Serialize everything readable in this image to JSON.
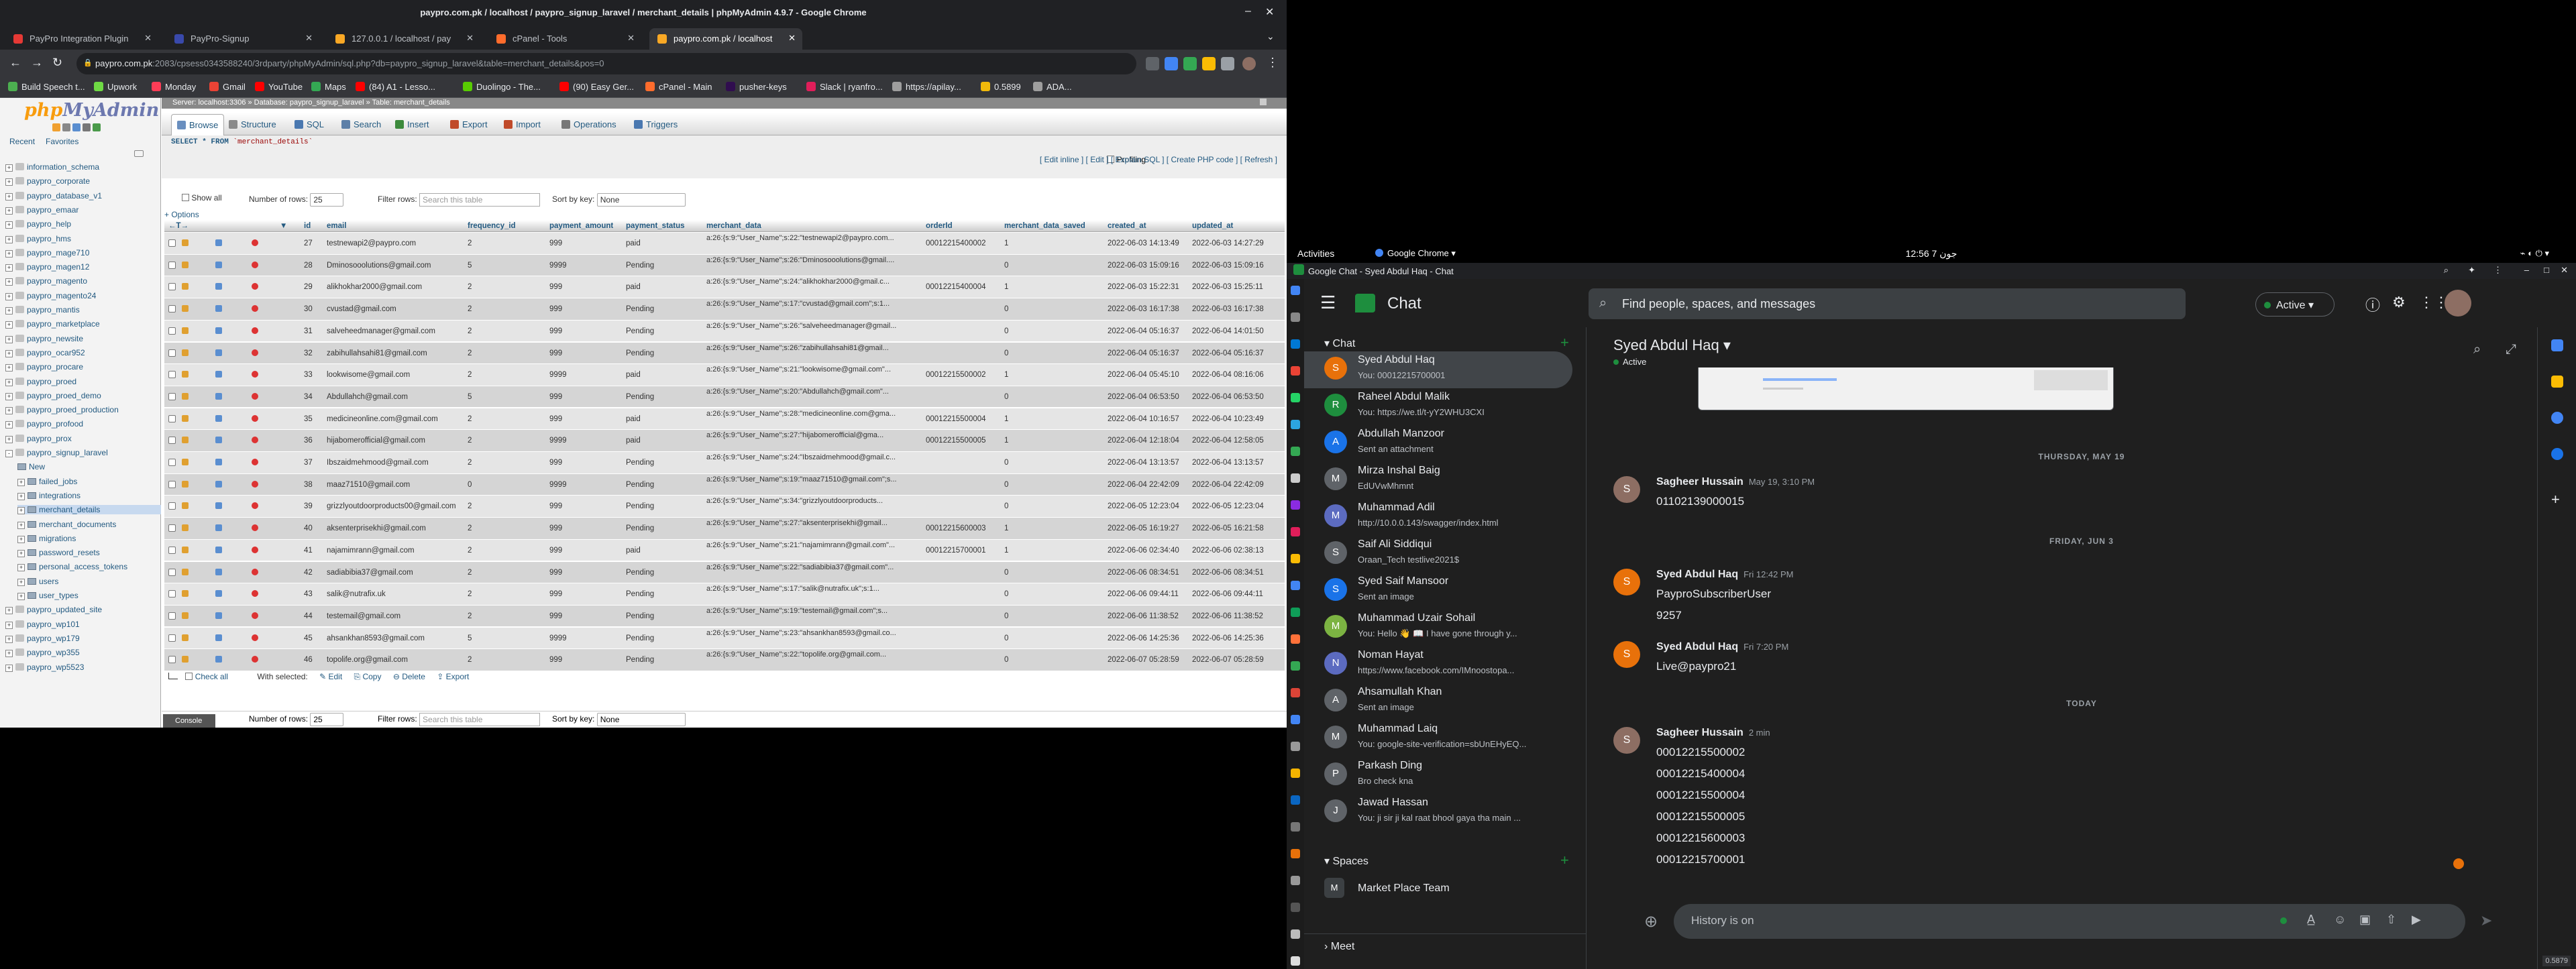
{
  "left_window": {
    "title": "paypro.com.pk / localhost / paypro_signup_laravel / merchant_details | phpMyAdmin 4.9.7 - Google Chrome",
    "tabs": [
      {
        "label": "PayPro Integration Plugin",
        "color": "#e53935"
      },
      {
        "label": "PayPro-Signup",
        "color": "#3949ab"
      },
      {
        "label": "127.0.0.1 / localhost / pay",
        "color": "#f9a825"
      },
      {
        "label": "cPanel - Tools",
        "color": "#ff6c2c"
      },
      {
        "label": "paypro.com.pk / localhost",
        "color": "#f9a825"
      }
    ],
    "url_host": "paypro.com.pk",
    "url_rest": ":2083/cpsess0343588240/3rdparty/phpMyAdmin/sql.php?db=paypro_signup_laravel&table=merchant_details&pos=0",
    "bookmarks": [
      {
        "label": "Build Speech t...",
        "color": "#4caf50"
      },
      {
        "label": "Upwork",
        "color": "#6fda44"
      },
      {
        "label": "Monday",
        "color": "#ff3d57"
      },
      {
        "label": "Gmail",
        "color": "#ea4335"
      },
      {
        "label": "YouTube",
        "color": "#ff0000"
      },
      {
        "label": "Maps",
        "color": "#34a853"
      },
      {
        "label": "(84) A1 - Lesso...",
        "color": "#ff0000"
      },
      {
        "label": "Duolingo - The...",
        "color": "#58cc02"
      },
      {
        "label": "(90) Easy Ger...",
        "color": "#ff0000"
      },
      {
        "label": "cPanel - Main",
        "color": "#ff6c2c"
      },
      {
        "label": "pusher-keys",
        "color": "#300d4f"
      },
      {
        "label": "Slack | ryanfro...",
        "color": "#e01e5a"
      },
      {
        "label": "https://apilay...",
        "color": "#9e9e9e"
      },
      {
        "label": "0.5899",
        "color": "#f0b90b"
      },
      {
        "label": "ADA...",
        "color": "#9e9e9e"
      }
    ]
  },
  "pma": {
    "logo_main": "php",
    "logo_accent": "MyAdmin",
    "recent": "Recent",
    "favorites": "Favorites",
    "databases": [
      {
        "name": "information_schema",
        "level": 0,
        "sign": "+"
      },
      {
        "name": "paypro_corporate",
        "level": 0,
        "sign": "+"
      },
      {
        "name": "paypro_database_v1",
        "level": 0,
        "sign": "+"
      },
      {
        "name": "paypro_emaar",
        "level": 0,
        "sign": "+"
      },
      {
        "name": "paypro_help",
        "level": 0,
        "sign": "+"
      },
      {
        "name": "paypro_hms",
        "level": 0,
        "sign": "+"
      },
      {
        "name": "paypro_mage710",
        "level": 0,
        "sign": "+"
      },
      {
        "name": "paypro_magen12",
        "level": 0,
        "sign": "+"
      },
      {
        "name": "paypro_magento",
        "level": 0,
        "sign": "+"
      },
      {
        "name": "paypro_magento24",
        "level": 0,
        "sign": "+"
      },
      {
        "name": "paypro_mantis",
        "level": 0,
        "sign": "+"
      },
      {
        "name": "paypro_marketplace",
        "level": 0,
        "sign": "+"
      },
      {
        "name": "paypro_newsite",
        "level": 0,
        "sign": "+"
      },
      {
        "name": "paypro_ocar952",
        "level": 0,
        "sign": "+"
      },
      {
        "name": "paypro_procare",
        "level": 0,
        "sign": "+"
      },
      {
        "name": "paypro_proed",
        "level": 0,
        "sign": "+"
      },
      {
        "name": "paypro_proed_demo",
        "level": 0,
        "sign": "+"
      },
      {
        "name": "paypro_proed_production",
        "level": 0,
        "sign": "+"
      },
      {
        "name": "paypro_profood",
        "level": 0,
        "sign": "+"
      },
      {
        "name": "paypro_prox",
        "level": 0,
        "sign": "+"
      },
      {
        "name": "paypro_signup_laravel",
        "level": 0,
        "sign": "-"
      },
      {
        "name": "New",
        "level": 1,
        "sign": ""
      },
      {
        "name": "failed_jobs",
        "level": 1,
        "sign": "+"
      },
      {
        "name": "integrations",
        "level": 1,
        "sign": "+"
      },
      {
        "name": "merchant_details",
        "level": 1,
        "sign": "+"
      },
      {
        "name": "merchant_documents",
        "level": 1,
        "sign": "+"
      },
      {
        "name": "migrations",
        "level": 1,
        "sign": "+"
      },
      {
        "name": "password_resets",
        "level": 1,
        "sign": "+"
      },
      {
        "name": "personal_access_tokens",
        "level": 1,
        "sign": "+"
      },
      {
        "name": "users",
        "level": 1,
        "sign": "+"
      },
      {
        "name": "user_types",
        "level": 1,
        "sign": "+"
      },
      {
        "name": "paypro_updated_site",
        "level": 0,
        "sign": "+"
      },
      {
        "name": "paypro_wp101",
        "level": 0,
        "sign": "+"
      },
      {
        "name": "paypro_wp179",
        "level": 0,
        "sign": "+"
      },
      {
        "name": "paypro_wp355",
        "level": 0,
        "sign": "+"
      },
      {
        "name": "paypro_wp5523",
        "level": 0,
        "sign": "+"
      }
    ],
    "server_bar": "Server: localhost:3306 » Database: paypro_signup_laravel » Table: merchant_details",
    "menu": [
      {
        "label": "Browse",
        "color": "#6a8fbf"
      },
      {
        "label": "Structure",
        "color": "#8a8a8a"
      },
      {
        "label": "SQL",
        "color": "#4a78b0"
      },
      {
        "label": "Search",
        "color": "#5d7fa8"
      },
      {
        "label": "Insert",
        "color": "#3c8a3c"
      },
      {
        "label": "Export",
        "color": "#c04a2a"
      },
      {
        "label": "Import",
        "color": "#c04a2a"
      },
      {
        "label": "Operations",
        "color": "#777777"
      },
      {
        "label": "Triggers",
        "color": "#4a78b0"
      }
    ],
    "sql_kw": "SELECT * FROM",
    "sql_table": "`merchant_details`",
    "profiling": "Profiling",
    "sql_links": "[ Edit inline ] [ Edit ] [ Explain SQL ] [ Create PHP code ] [ Refresh ]",
    "show_all": "Show all",
    "num_rows_label": "Number of rows:",
    "num_rows_value": "25",
    "filter_label": "Filter rows:",
    "filter_placeholder": "Search this table",
    "sort_label": "Sort by key:",
    "sort_value": "None",
    "options": "+ Options",
    "columns": [
      "id",
      "email",
      "frequency_id",
      "payment_amount",
      "payment_status",
      "merchant_data",
      "orderId",
      "merchant_data_saved",
      "created_at",
      "updated_at"
    ],
    "action_labels": {
      "edit": "Edit",
      "copy": "Copy",
      "delete": "Delete"
    },
    "rows": [
      {
        "id": "27",
        "email": "testnewapi2@paypro.com",
        "freq": "2",
        "amount": "999",
        "status": "paid",
        "md": "a:26:{s:9:\"User_Name\";s:22:\"testnewapi2@paypro.com...",
        "order": "00012215400002",
        "saved": "1",
        "created": "2022-06-03 14:13:49",
        "updated": "2022-06-03 14:27:29"
      },
      {
        "id": "28",
        "email": "Dminosooolutions@gmail.com",
        "freq": "5",
        "amount": "9999",
        "status": "Pending",
        "md": "a:26:{s:9:\"User_Name\";s:26:\"Dminosooolutions@gmail....",
        "order": "",
        "saved": "0",
        "created": "2022-06-03 15:09:16",
        "updated": "2022-06-03 15:09:16"
      },
      {
        "id": "29",
        "email": "alikhokhar2000@gmail.com",
        "freq": "2",
        "amount": "999",
        "status": "paid",
        "md": "a:26:{s:9:\"User_Name\";s:24:\"alikhokhar2000@gmail.c...",
        "order": "00012215400004",
        "saved": "1",
        "created": "2022-06-03 15:22:31",
        "updated": "2022-06-03 15:25:11"
      },
      {
        "id": "30",
        "email": "cvustad@gmail.com",
        "freq": "2",
        "amount": "999",
        "status": "Pending",
        "md": "a:26:{s:9:\"User_Name\";s:17:\"cvustad@gmail.com\";s:1...",
        "order": "",
        "saved": "0",
        "created": "2022-06-03 16:17:38",
        "updated": "2022-06-03 16:17:38"
      },
      {
        "id": "31",
        "email": "salveheedmanager@gmail.com",
        "freq": "2",
        "amount": "999",
        "status": "Pending",
        "md": "a:26:{s:9:\"User_Name\";s:26:\"salveheedmanager@gmail...",
        "order": "",
        "saved": "0",
        "created": "2022-06-04 05:16:37",
        "updated": "2022-06-04 14:01:50"
      },
      {
        "id": "32",
        "email": "zabihullahsahi81@gmail.com",
        "freq": "2",
        "amount": "999",
        "status": "Pending",
        "md": "a:26:{s:9:\"User_Name\";s:26:\"zabihullahsahi81@gmail...",
        "order": "",
        "saved": "0",
        "created": "2022-06-04 05:16:37",
        "updated": "2022-06-04 05:16:37"
      },
      {
        "id": "33",
        "email": "lookwisome@gmail.com",
        "freq": "2",
        "amount": "9999",
        "status": "paid",
        "md": "a:26:{s:9:\"User_Name\";s:21:\"lookwisome@gmail.com\"...",
        "order": "00012215500002",
        "saved": "1",
        "created": "2022-06-04 05:45:10",
        "updated": "2022-06-04 08:16:06"
      },
      {
        "id": "34",
        "email": "Abdullahch@gmail.com",
        "freq": "5",
        "amount": "999",
        "status": "Pending",
        "md": "a:26:{s:9:\"User_Name\";s:20:\"Abdullahch@gmail.com\"...",
        "order": "",
        "saved": "0",
        "created": "2022-06-04 06:53:50",
        "updated": "2022-06-04 06:53:50"
      },
      {
        "id": "35",
        "email": "medicineonline.com@gmail.com",
        "freq": "2",
        "amount": "999",
        "status": "paid",
        "md": "a:26:{s:9:\"User_Name\";s:28:\"medicineonline.com@gma...",
        "order": "00012215500004",
        "saved": "1",
        "created": "2022-06-04 10:16:57",
        "updated": "2022-06-04 10:23:49"
      },
      {
        "id": "36",
        "email": "hijabomerofficial@gmail.com",
        "freq": "2",
        "amount": "9999",
        "status": "paid",
        "md": "a:26:{s:9:\"User_Name\";s:27:\"hijabomerofficial@gma...",
        "order": "00012215500005",
        "saved": "1",
        "created": "2022-06-04 12:18:04",
        "updated": "2022-06-04 12:58:05"
      },
      {
        "id": "37",
        "email": "Ibszaidmehmood@gmail.com",
        "freq": "2",
        "amount": "999",
        "status": "Pending",
        "md": "a:26:{s:9:\"User_Name\";s:24:\"Ibszaidmehmood@gmail.c...",
        "order": "",
        "saved": "0",
        "created": "2022-06-04 13:13:57",
        "updated": "2022-06-04 13:13:57"
      },
      {
        "id": "38",
        "email": "maaz71510@gmail.com",
        "freq": "0",
        "amount": "9999",
        "status": "Pending",
        "md": "a:26:{s:9:\"User_Name\";s:19:\"maaz71510@gmail.com\";s...",
        "order": "",
        "saved": "0",
        "created": "2022-06-04 22:42:09",
        "updated": "2022-06-04 22:42:09"
      },
      {
        "id": "39",
        "email": "grizzlyoutdoorproducts00@gmail.com",
        "freq": "2",
        "amount": "999",
        "status": "Pending",
        "md": "a:26:{s:9:\"User_Name\";s:34:\"grizzlyoutdoorproducts...",
        "order": "",
        "saved": "0",
        "created": "2022-06-05 12:23:04",
        "updated": "2022-06-05 12:23:04"
      },
      {
        "id": "40",
        "email": "aksenterprisekhi@gmail.com",
        "freq": "2",
        "amount": "999",
        "status": "Pending",
        "md": "a:26:{s:9:\"User_Name\";s:27:\"aksenterprisekhi@gmail...",
        "order": "00012215600003",
        "saved": "1",
        "created": "2022-06-05 16:19:27",
        "updated": "2022-06-05 16:21:58"
      },
      {
        "id": "41",
        "email": "najamimrann@gmail.com",
        "freq": "2",
        "amount": "999",
        "status": "paid",
        "md": "a:26:{s:9:\"User_Name\";s:21:\"najamimrann@gmail.com\"...",
        "order": "00012215700001",
        "saved": "1",
        "created": "2022-06-06 02:34:40",
        "updated": "2022-06-06 02:38:13"
      },
      {
        "id": "42",
        "email": "sadiabibia37@gmail.com",
        "freq": "2",
        "amount": "999",
        "status": "Pending",
        "md": "a:26:{s:9:\"User_Name\";s:22:\"sadiabibia37@gmail.com\"...",
        "order": "",
        "saved": "0",
        "created": "2022-06-06 08:34:51",
        "updated": "2022-06-06 08:34:51"
      },
      {
        "id": "43",
        "email": "salik@nutrafix.uk",
        "freq": "2",
        "amount": "999",
        "status": "Pending",
        "md": "a:26:{s:9:\"User_Name\";s:17:\"salik@nutrafix.uk\";s:1...",
        "order": "",
        "saved": "0",
        "created": "2022-06-06 09:44:11",
        "updated": "2022-06-06 09:44:11"
      },
      {
        "id": "44",
        "email": "testemail@gmail.com",
        "freq": "2",
        "amount": "999",
        "status": "Pending",
        "md": "a:26:{s:9:\"User_Name\";s:19:\"testemail@gmail.com\";s...",
        "order": "",
        "saved": "0",
        "created": "2022-06-06 11:38:52",
        "updated": "2022-06-06 11:38:52"
      },
      {
        "id": "45",
        "email": "ahsankhan8593@gmail.com",
        "freq": "5",
        "amount": "9999",
        "status": "Pending",
        "md": "a:26:{s:9:\"User_Name\";s:23:\"ahsankhan8593@gmail.co...",
        "order": "",
        "saved": "0",
        "created": "2022-06-06 14:25:36",
        "updated": "2022-06-06 14:25:36"
      },
      {
        "id": "46",
        "email": "topolife.org@gmail.com",
        "freq": "2",
        "amount": "999",
        "status": "Pending",
        "md": "a:26:{s:9:\"User_Name\";s:22:\"topolife.org@gmail.com...",
        "order": "",
        "saved": "0",
        "created": "2022-06-07 05:28:59",
        "updated": "2022-06-07 05:28:59"
      }
    ],
    "check_all": "Check all",
    "with_selected": "With selected:",
    "bulk_edit": "Edit",
    "bulk_copy": "Copy",
    "bulk_delete": "Delete",
    "bulk_export": "Export",
    "console": "Console"
  },
  "desktop": {
    "activities": "Activities",
    "app_menu": "Google Chrome",
    "clock": "12:56  جون 7",
    "window_title": "Google Chat - Syed Abdul Haq - Chat"
  },
  "chat": {
    "app_name": "Chat",
    "search_placeholder": "Find people, spaces, and messages",
    "status": "Active",
    "section_chat": "Chat",
    "section_spaces": "Spaces",
    "section_meet": "Meet",
    "conversations": [
      {
        "name": "Syed Abdul Haq",
        "preview": "You: 00012215700001",
        "initial": "S",
        "color": "#e8710a",
        "selected": true
      },
      {
        "name": "Raheel Abdul Malik",
        "preview": "You: https://we.tl/t-yY2WHU3CXI",
        "initial": "R",
        "color": "#1e8e3e",
        "selected": false
      },
      {
        "name": "Abdullah Manzoor",
        "preview": "Sent an attachment",
        "initial": "A",
        "color": "#1a73e8",
        "selected": false
      },
      {
        "name": "Mirza Inshal Baig",
        "preview": "EdUVwMhmnt",
        "initial": "M",
        "color": "#5f6368",
        "selected": false
      },
      {
        "name": "Muhammad Adil",
        "preview": "http://10.0.0.143/swagger/index.html",
        "initial": "M",
        "color": "#5c6bc0",
        "selected": false
      },
      {
        "name": "Saif Ali Siddiqui",
        "preview": "Oraan_Tech testlive2021$",
        "initial": "S",
        "color": "#5f6368",
        "selected": false
      },
      {
        "name": "Syed Saif Mansoor",
        "preview": "Sent an image",
        "initial": "S",
        "color": "#1a73e8",
        "selected": false
      },
      {
        "name": "Muhammad Uzair Sohail",
        "preview": "You: Hello 👋 📖 I have gone through y...",
        "initial": "M",
        "color": "#7cb342",
        "selected": false
      },
      {
        "name": "Noman Hayat",
        "preview": "https://www.facebook.com/IMnoostopa...",
        "initial": "N",
        "color": "#5c6bc0",
        "selected": false
      },
      {
        "name": "Ahsamullah Khan",
        "preview": "Sent an image",
        "initial": "A",
        "color": "#5f6368",
        "selected": false
      },
      {
        "name": "Muhammad Laiq",
        "preview": "You: google-site-verification=sbUnEHyEQ...",
        "initial": "M",
        "color": "#5f6368",
        "selected": false
      },
      {
        "name": "Parkash Ding",
        "preview": "Bro check kna",
        "initial": "P",
        "color": "#5f6368",
        "selected": false
      },
      {
        "name": "Jawad Hassan",
        "preview": "You: ji sir ji kal raat bhool gaya tha main ...",
        "initial": "J",
        "color": "#5f6368",
        "selected": false
      }
    ],
    "spaces": [
      {
        "name": "Market Place Team",
        "initial": "M"
      }
    ],
    "convo_name": "Syed Abdul Haq",
    "convo_status": "Active",
    "day1": "THURSDAY, MAY 19",
    "day2": "FRIDAY, JUN 3",
    "day3": "TODAY",
    "messages": [
      {
        "author": "Sagheer Hussain",
        "time": "May 19, 3:10 PM",
        "initial": "S",
        "color": "#8d6e63",
        "lines": [
          "01102139000015"
        ]
      },
      {
        "author": "Syed Abdul Haq",
        "time": "Fri 12:42 PM",
        "initial": "S",
        "color": "#e8710a",
        "lines": [
          "PayproSubscriberUser",
          "9257"
        ]
      },
      {
        "author": "Syed Abdul Haq",
        "time": "Fri 7:20 PM",
        "initial": "S",
        "color": "#e8710a",
        "lines": [
          "Live@paypro21"
        ]
      },
      {
        "author": "Sagheer Hussain",
        "time": "2 min",
        "initial": "S",
        "color": "#8d6e63",
        "lines": [
          "00012215500002",
          "00012215400004",
          "00012215500004",
          "00012215500005",
          "00012215600003",
          "00012215700001"
        ]
      }
    ],
    "composer_placeholder": "History is on",
    "corner_value": "0.5879"
  }
}
